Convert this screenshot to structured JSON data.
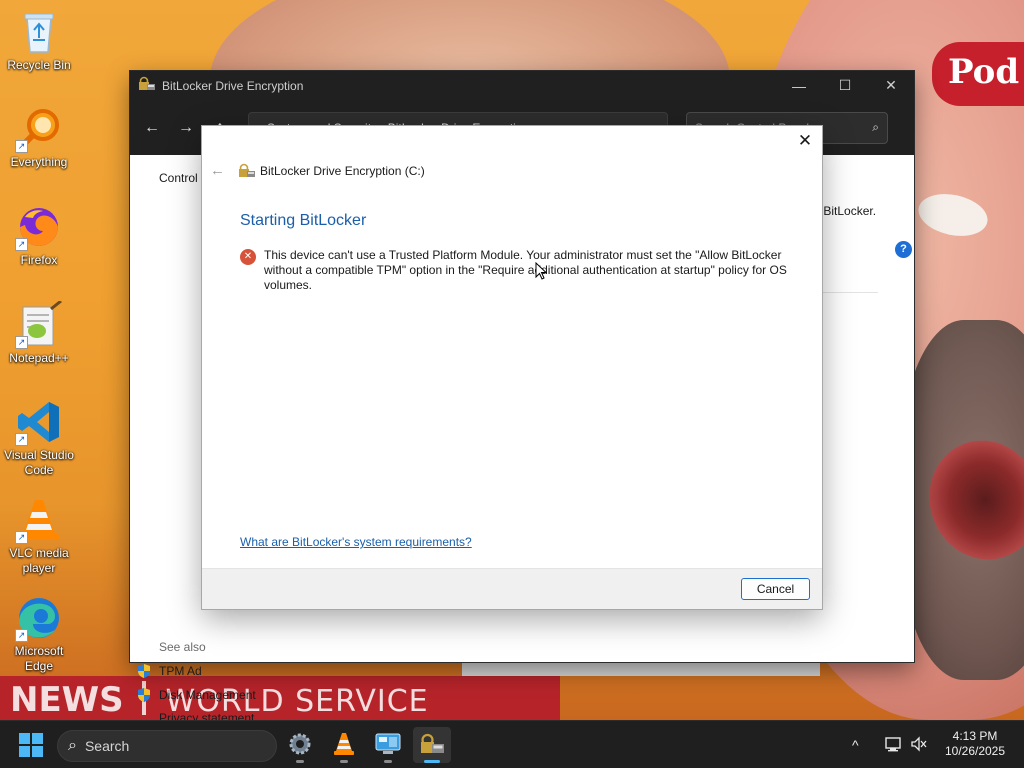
{
  "desktop": {
    "wallpaper": {
      "pod_text": "Pod",
      "news_text": "NEWS",
      "world_service_text": "WORLD SERVICE"
    },
    "icons": [
      {
        "label": "Recycle Bin",
        "icon": "recycle-bin-icon"
      },
      {
        "label": "Everything",
        "icon": "everything-search-icon"
      },
      {
        "label": "Firefox",
        "icon": "firefox-icon"
      },
      {
        "label": "Notepad++",
        "icon": "notepadpp-icon"
      },
      {
        "label": "Visual Studio Code",
        "icon": "vscode-icon"
      },
      {
        "label": "VLC media player",
        "icon": "vlc-icon"
      },
      {
        "label": "Microsoft Edge",
        "icon": "edge-icon"
      }
    ]
  },
  "window": {
    "title": "BitLocker Drive Encryption",
    "controls": {
      "minimize": "—",
      "maximize": "☐",
      "close": "✕"
    },
    "nav": {
      "back": "←",
      "forward": "→",
      "up": "↑"
    },
    "address": "« System and Security › BitLocker Drive Encryption",
    "search_placeholder": "Search Control Panel",
    "body": {
      "crumb": "Control",
      "right_text": "th BitLocker.",
      "help": "?",
      "see_also": "See also",
      "links": [
        "TPM Ad",
        "Disk Management",
        "Privacy statement"
      ]
    }
  },
  "dialog": {
    "close": "✕",
    "back": "←",
    "header": "BitLocker Drive Encryption (C:)",
    "title": "Starting BitLocker",
    "error_glyph": "✕",
    "message": "This device can't use a Trusted Platform Module. Your administrator must set the \"Allow BitLocker without a compatible TPM\" option in the \"Require additional authentication at startup\" policy for OS volumes.",
    "requirements_link": "What are BitLocker's system requirements?",
    "cancel_label": "Cancel"
  },
  "taskbar": {
    "search_label": "Search",
    "apps": [
      {
        "name": "settings-app",
        "active": false
      },
      {
        "name": "vlc-app",
        "active": false
      },
      {
        "name": "control-panel-app",
        "active": false
      },
      {
        "name": "bitlocker-app",
        "active": true
      }
    ],
    "tray": {
      "chevron": "^"
    },
    "clock": {
      "time": "4:13 PM",
      "date": "10/26/2025"
    }
  },
  "colors": {
    "accent": "#1b5faa",
    "link": "#1b5faa",
    "error": "#d6533a",
    "taskbar": "#1f1f1f",
    "titlebar": "#202020"
  }
}
